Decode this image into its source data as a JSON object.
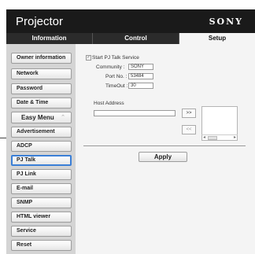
{
  "header": {
    "title": "Projector",
    "logo": "SONY"
  },
  "tabs": [
    {
      "label": "Information"
    },
    {
      "label": "Control"
    },
    {
      "label": "Setup"
    }
  ],
  "sidebar": {
    "items": [
      {
        "label": "Owner information"
      },
      {
        "label": "Network"
      },
      {
        "label": "Password"
      },
      {
        "label": "Date & Time"
      },
      {
        "label": "Easy Menu",
        "caret": "⌃"
      },
      {
        "label": "Advertisement"
      },
      {
        "label": "ADCP"
      },
      {
        "label": "PJ Talk"
      },
      {
        "label": "PJ Link"
      },
      {
        "label": "E-mail"
      },
      {
        "label": "SNMP"
      },
      {
        "label": "HTML viewer"
      },
      {
        "label": "Service"
      },
      {
        "label": "Reset"
      }
    ],
    "active": "PJ Talk"
  },
  "form": {
    "start_service_label": "Start PJ Talk Service",
    "start_service_checked": true,
    "community_label": "Community :",
    "community_value": "SONY",
    "port_label": "Port No. :",
    "port_value": "53484",
    "timeout_label": "TimeOut :",
    "timeout_value": "30",
    "host_address_label": "Host Address",
    "host_address_value": "",
    "add_button": ">>",
    "remove_button": "<<",
    "apply_button": "Apply"
  },
  "icons": {
    "checkbox": "check-icon",
    "scroll_left": "arrow-left-icon",
    "scroll_right": "arrow-right-icon"
  }
}
